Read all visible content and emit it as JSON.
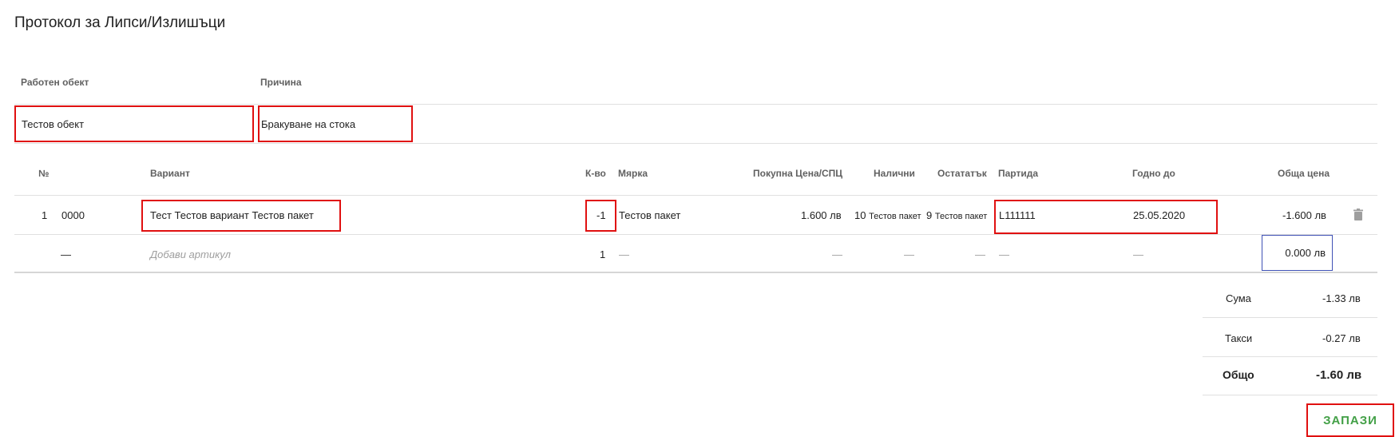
{
  "page": {
    "title": "Протокол за Липси/Излишъци"
  },
  "form": {
    "work_object_label": "Работен обект",
    "work_object_value": "Тестов обект",
    "reason_label": "Причина",
    "reason_value": "Бракуване на стока"
  },
  "table": {
    "headers": {
      "num": "№",
      "variant": "Вариант",
      "qty": "К-во",
      "unit": "Мярка",
      "price": "Покупна Цена/СПЦ",
      "available": "Налични",
      "remainder": "Остататък",
      "batch": "Партида",
      "expiry": "Годно до",
      "total": "Обща цена"
    },
    "row": {
      "num": "1",
      "code": "0000",
      "variant": "Тест Тестов вариант Тестов пакет",
      "qty": "-1",
      "unit": "Тестов пакет",
      "price": "1.600 лв",
      "available_qty": "10",
      "available_unit": "Тестов пакет",
      "remainder_qty": "9",
      "remainder_unit": "Тестов пакет",
      "batch": "L111111",
      "expiry": "25.05.2020",
      "total": "-1.600 лв"
    },
    "add_row": {
      "code": "—",
      "placeholder": "Добави артикул",
      "qty": "1",
      "unit": "—",
      "price": "—",
      "available": "—",
      "remainder": "—",
      "batch": "—",
      "expiry": "—",
      "total": "0.000 лв"
    }
  },
  "totals": {
    "sum_label": "Сума",
    "sum_value": "-1.33 лв",
    "taxes_label": "Такси",
    "taxes_value": "-0.27 лв",
    "total_label": "Общо",
    "total_value": "-1.60 лв"
  },
  "actions": {
    "save_label": "ЗАПАЗИ"
  },
  "colors": {
    "highlight": "#e01010",
    "accent": "#3f51b5",
    "save": "#43a047"
  }
}
